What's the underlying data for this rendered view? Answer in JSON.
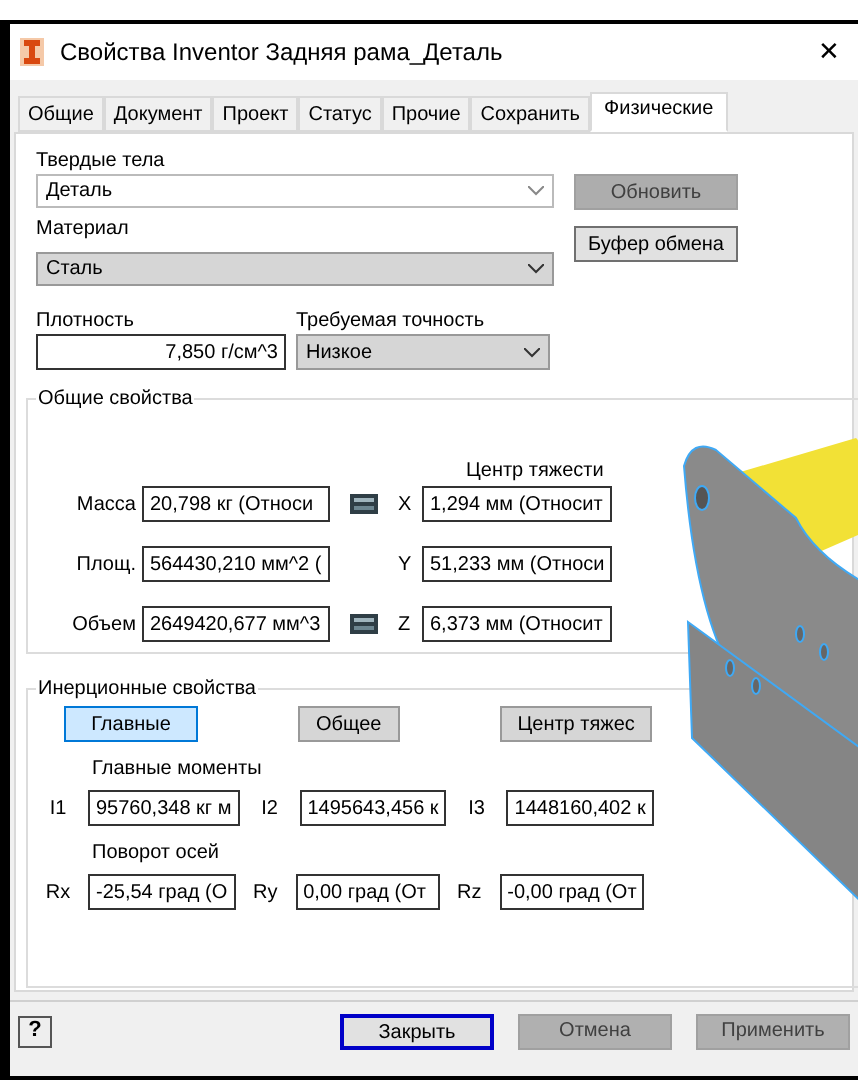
{
  "window": {
    "title": "Свойства Inventor Задняя рама_Деталь",
    "close": "✕"
  },
  "tabs": [
    {
      "label": "Общие",
      "selected": false
    },
    {
      "label": "Документ",
      "selected": false
    },
    {
      "label": "Проект",
      "selected": false
    },
    {
      "label": "Статус",
      "selected": false
    },
    {
      "label": "Прочие",
      "selected": false
    },
    {
      "label": "Сохранить",
      "selected": false
    },
    {
      "label": "Физические",
      "selected": true
    }
  ],
  "solid_bodies": {
    "label": "Твердые тела",
    "value": "Деталь"
  },
  "material": {
    "label": "Материал",
    "value": "Сталь"
  },
  "side_buttons": [
    {
      "label": "Обновить",
      "disabled": true
    },
    {
      "label": "Буфер обмена",
      "disabled": false
    }
  ],
  "density": {
    "label": "Плотность",
    "value": "7,850 г/см^3"
  },
  "accuracy": {
    "label": "Требуемая точность",
    "value": "Низкое"
  },
  "general": {
    "title": "Общие свойства",
    "center_label": "Центр тяжести",
    "rows": [
      {
        "label": "Масса",
        "value": "20,798 кг (Относи",
        "calculator": true,
        "axis": "X",
        "center": "1,294 мм (Относит"
      },
      {
        "label": "Площ.",
        "value": "564430,210 мм^2 (",
        "calculator": false,
        "axis": "Y",
        "center": "51,233 мм (Относи"
      },
      {
        "label": "Объем",
        "value": "2649420,677 мм^3",
        "calculator": true,
        "axis": "Z",
        "center": "6,373 мм (Относит"
      }
    ]
  },
  "inertia": {
    "title": "Инерционные свойства",
    "modes": [
      {
        "label": "Главные",
        "selected": true
      },
      {
        "label": "Общее",
        "selected": false
      },
      {
        "label": "Центр тяжес",
        "selected": false
      }
    ],
    "moments_label": "Главные моменты",
    "moments": [
      {
        "label": "I1",
        "value": "95760,348 кг м"
      },
      {
        "label": "I2",
        "value": "1495643,456 к"
      },
      {
        "label": "I3",
        "value": "1448160,402 к"
      }
    ],
    "rotation_label": "Поворот осей",
    "rotation": [
      {
        "label": "Rx",
        "value": "-25,54 град (О"
      },
      {
        "label": "Ry",
        "value": "0,00 град (От"
      },
      {
        "label": "Rz",
        "value": "-0,00 град (От"
      }
    ]
  },
  "footer": {
    "help": "?",
    "buttons": [
      {
        "label": "Закрыть",
        "disabled": false
      },
      {
        "label": "Отмена",
        "disabled": true
      },
      {
        "label": "Применить",
        "disabled": true
      }
    ]
  }
}
